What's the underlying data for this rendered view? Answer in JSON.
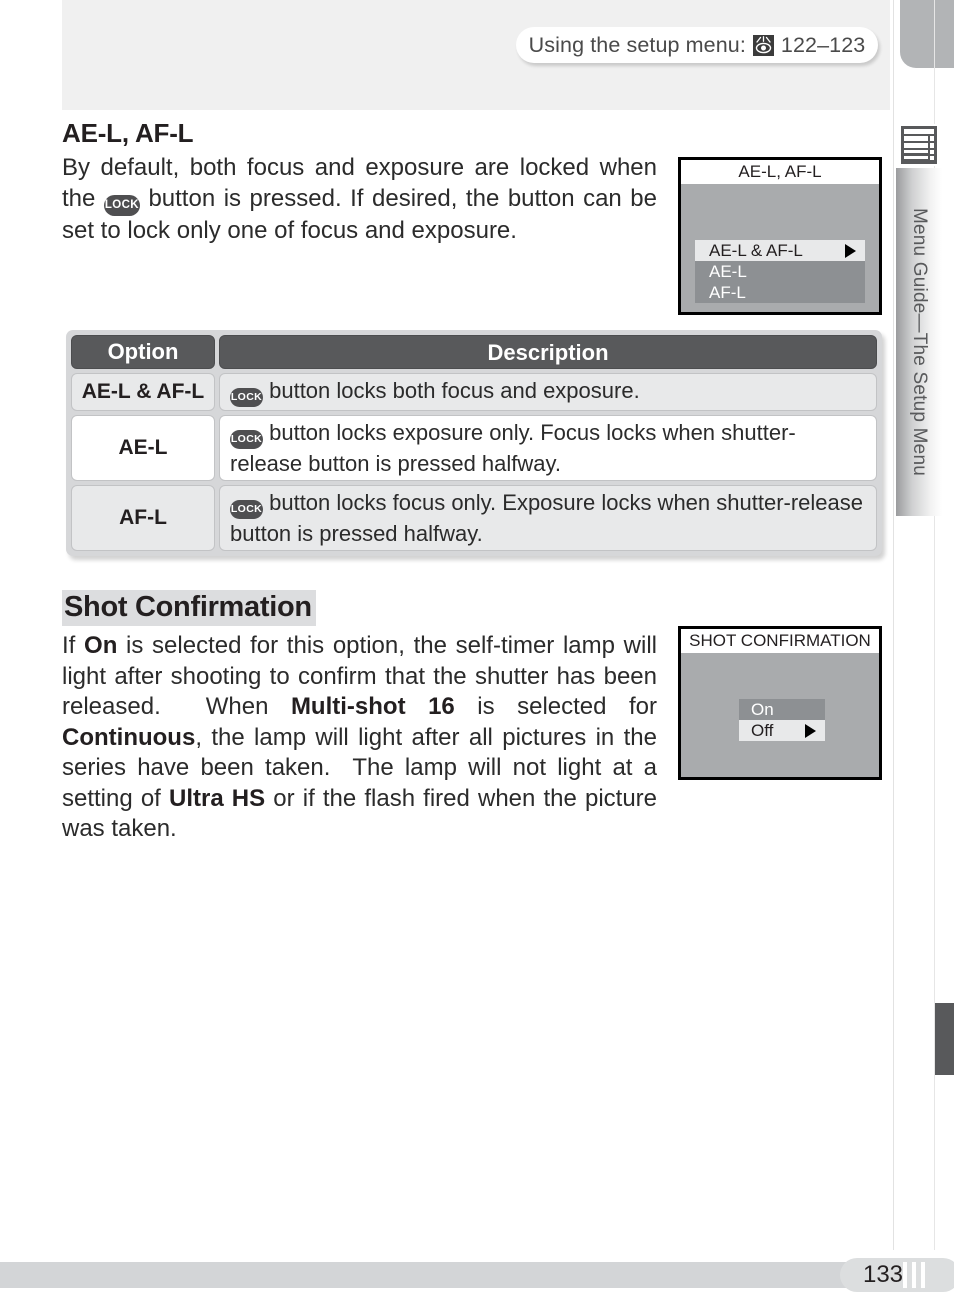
{
  "header": {
    "reference_text_before": "Using the setup menu:",
    "icon": "eye-reference-icon",
    "pages": "122–123"
  },
  "sidebar": {
    "icon": "menu-list-icon",
    "label": "Menu Guide—The Setup Menu"
  },
  "footer": {
    "page_number": "133"
  },
  "sections": [
    {
      "id": "ae-l-af-l",
      "heading": "AE-L, AF-L",
      "body_part1": "By default, both focus and exposure are locked when the ",
      "lock_icon": "LOCK",
      "body_part2": " button is pressed.  If desired, the button can be set to lock only one of focus and exposure."
    },
    {
      "id": "shot-confirmation",
      "heading": "Shot Confirmation",
      "body": "If On is selected for this option, the self-timer lamp will light after shooting to confirm that the shutter has been released.  When Multi-shot 16 is selected for Continuous, the lamp will light after all pictures in the series have been taken.  The lamp will not light at a setting of Ultra HS or if the flash fired when the picture was taken."
    }
  ],
  "lcd_screens": [
    {
      "id": "ae-l-af-l-screen",
      "title": "AE-L, AF-L",
      "items": [
        {
          "label": "AE-L & AF-L",
          "selected": true,
          "arrow": true
        },
        {
          "label": "AE-L",
          "selected": false,
          "arrow": false
        },
        {
          "label": "AF-L",
          "selected": false,
          "arrow": false
        }
      ]
    },
    {
      "id": "shot-confirmation-screen",
      "title": "SHOT CONFIRMATION",
      "items": [
        {
          "label": "On",
          "selected": false,
          "arrow": false
        },
        {
          "label": "Off",
          "selected": true,
          "arrow": true
        }
      ]
    }
  ],
  "table": {
    "columns": [
      "Option",
      "Description"
    ],
    "rows": [
      {
        "option": "AE-L & AF-L",
        "lock_icon": "LOCK",
        "description": " button locks both focus and exposure."
      },
      {
        "option": "AE-L",
        "lock_icon": "LOCK",
        "description": " button locks exposure only.   Focus locks when shutter-release button is pressed halfway."
      },
      {
        "option": "AF-L",
        "lock_icon": "LOCK",
        "description": " button locks focus only.   Exposure locks when shutter-release button is pressed halfway."
      }
    ]
  },
  "colors": {
    "header_band": "#f0f0f0",
    "table_header": "#58595b",
    "lcd_background": "#a9abad",
    "lcd_menu": "#8d9093",
    "accent_gray": "#d3d5d7"
  }
}
